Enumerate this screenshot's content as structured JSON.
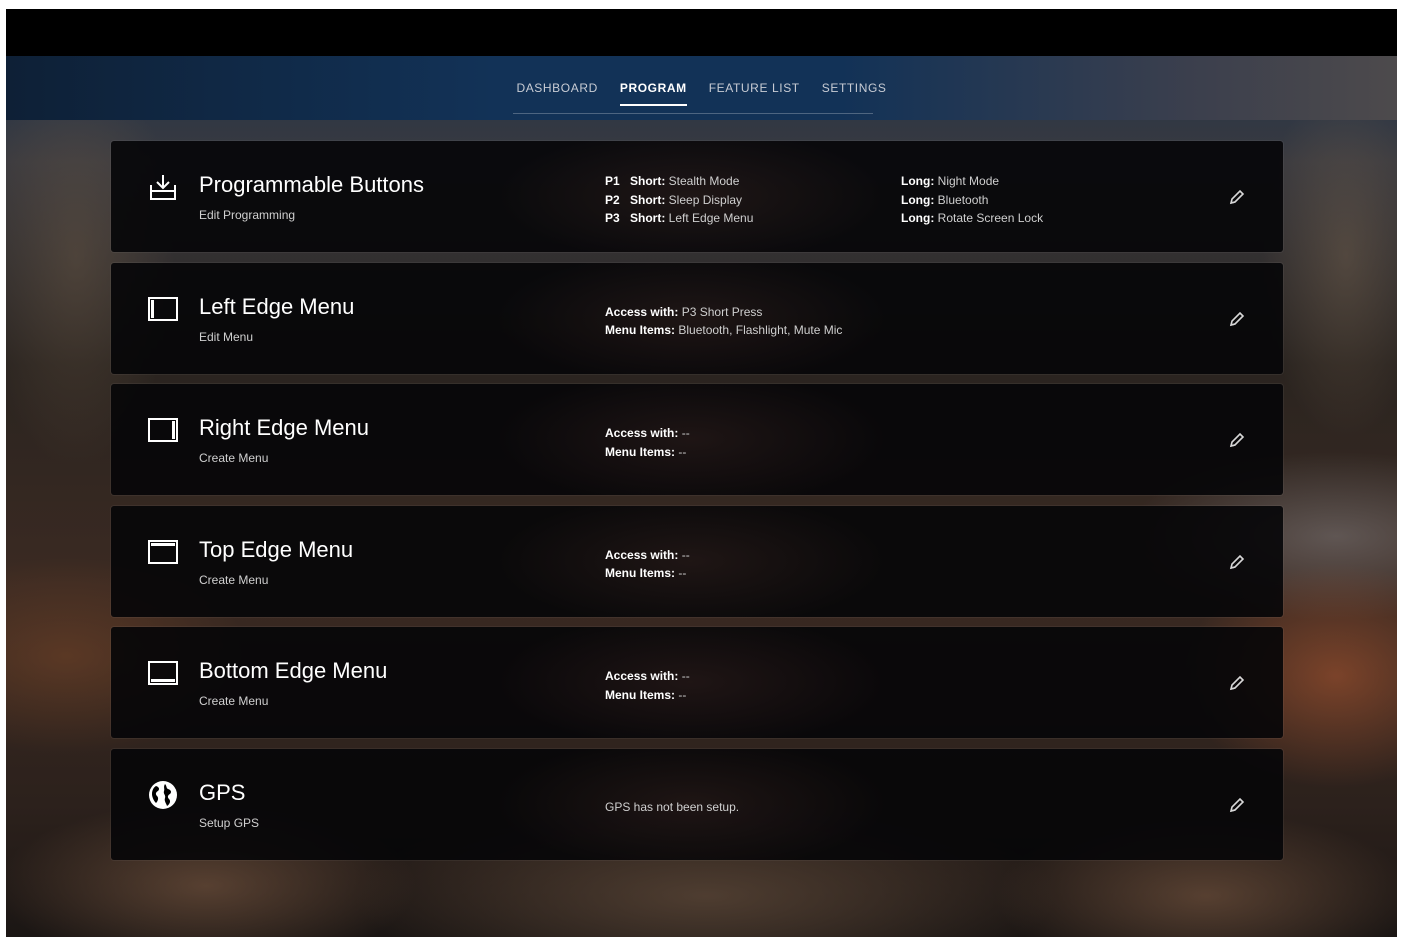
{
  "nav": {
    "tabs": [
      {
        "label": "DASHBOARD"
      },
      {
        "label": "PROGRAM"
      },
      {
        "label": "FEATURE LIST"
      },
      {
        "label": "SETTINGS"
      }
    ],
    "active_tab": "PROGRAM"
  },
  "cards": {
    "programmable": {
      "icon": "download-tray-icon",
      "title": "Programmable Buttons",
      "subtitle": "Edit Programming",
      "short_label": "Short:",
      "long_label": "Long:",
      "buttons": [
        {
          "key": "P1",
          "short": "Stealth Mode",
          "long": "Night Mode"
        },
        {
          "key": "P2",
          "short": "Sleep Display",
          "long": "Bluetooth"
        },
        {
          "key": "P3",
          "short": "Left Edge Menu",
          "long": "Rotate Screen Lock"
        }
      ]
    },
    "left_edge": {
      "icon": "left-edge-screen-icon",
      "title": "Left Edge Menu",
      "subtitle": "Edit Menu",
      "access_label": "Access with:",
      "access_value": "P3 Short Press",
      "items_label": "Menu Items:",
      "items_value": "Bluetooth, Flashlight, Mute Mic"
    },
    "right_edge": {
      "icon": "right-edge-screen-icon",
      "title": "Right Edge Menu",
      "subtitle": "Create Menu",
      "access_label": "Access with:",
      "access_value": "--",
      "items_label": "Menu Items:",
      "items_value": "--"
    },
    "top_edge": {
      "icon": "top-edge-screen-icon",
      "title": "Top Edge Menu",
      "subtitle": "Create Menu",
      "access_label": "Access with:",
      "access_value": "--",
      "items_label": "Menu Items:",
      "items_value": "--"
    },
    "bottom_edge": {
      "icon": "bottom-edge-screen-icon",
      "title": "Bottom Edge Menu",
      "subtitle": "Create Menu",
      "access_label": "Access with:",
      "access_value": "--",
      "items_label": "Menu Items:",
      "items_value": "--"
    },
    "gps": {
      "icon": "globe-icon",
      "title": "GPS",
      "subtitle": "Setup GPS",
      "status": "GPS has not been setup."
    }
  },
  "edit_icon": "pencil-icon"
}
